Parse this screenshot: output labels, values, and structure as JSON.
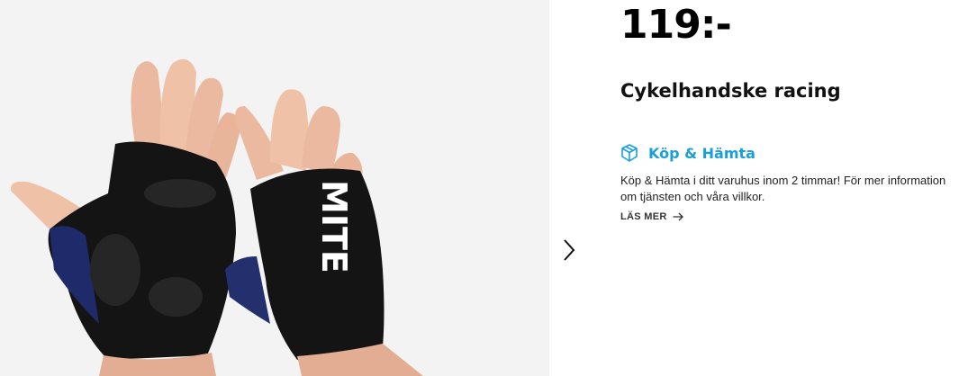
{
  "product": {
    "price": "119:-",
    "title": "Cykelhandske racing",
    "image_alt": "Cykelhandske racing"
  },
  "gallery": {
    "next_icon": "chevron-right-icon"
  },
  "service": {
    "icon": "package-icon",
    "label": "Köp & Hämta",
    "description": "Köp & Hämta i ditt varuhus inom 2 timmar! För mer information om tjänsten och våra villkor.",
    "read_more_label": "LÄS MER",
    "read_more_icon": "arrow-right-icon"
  },
  "colors": {
    "accent": "#1aa0d8",
    "price": "#000000",
    "gallery_bg": "#f3f3f3"
  }
}
